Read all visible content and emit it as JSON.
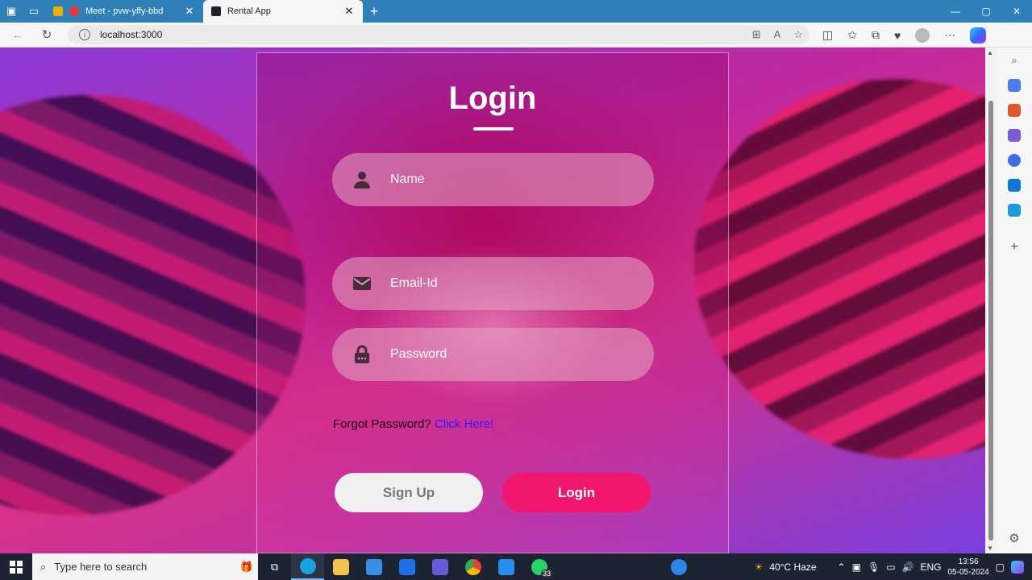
{
  "browser": {
    "tabs": [
      {
        "title": "Meet - pvw-yffy-bbd",
        "active": false
      },
      {
        "title": "Rental App",
        "active": true
      }
    ],
    "url": "localhost:3000"
  },
  "login": {
    "title": "Login",
    "name_placeholder": "Name",
    "email_placeholder": "Email-Id",
    "password_placeholder": "Password",
    "forgot_text": "Forgot Password?",
    "forgot_link": "Click Here!",
    "signup_label": "Sign Up",
    "login_label": "Login"
  },
  "taskbar": {
    "search_placeholder": "Type here to search",
    "whatsapp_badge": "33",
    "weather": "40°C  Haze",
    "language": "ENG",
    "time": "13:56",
    "date": "05-05-2024"
  },
  "colors": {
    "login_button": "#f3166f",
    "link": "#2a1bff",
    "browser_chrome": "#2f7fb9"
  }
}
